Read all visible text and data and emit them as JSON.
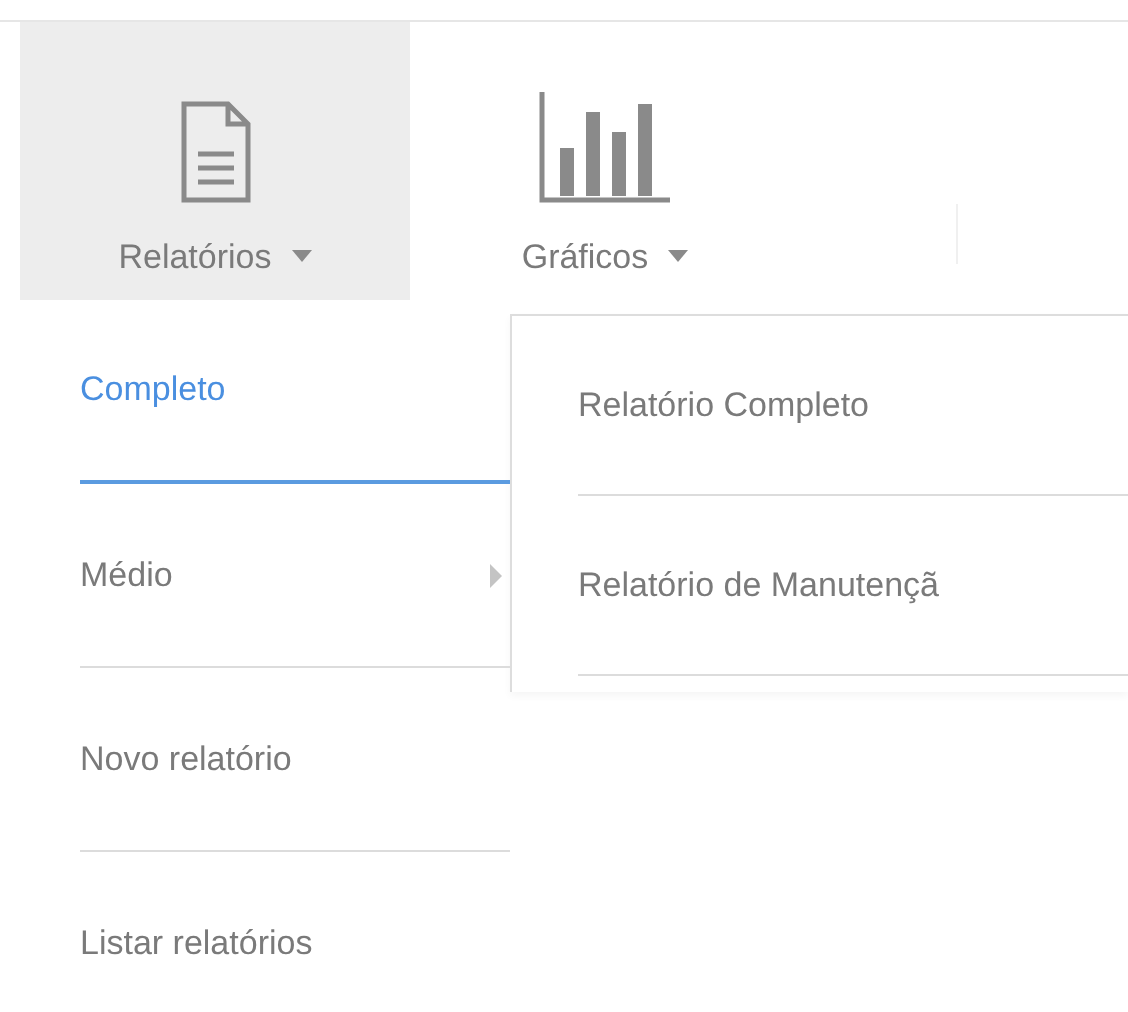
{
  "toolbar": {
    "tabs": [
      {
        "label": "Relatórios",
        "kind": "document",
        "selected": true,
        "menu": [
          {
            "label": "Completo",
            "selected": true,
            "has_submenu": false
          },
          {
            "label": "Médio",
            "selected": false,
            "has_submenu": true
          },
          {
            "label": "Novo relatório",
            "selected": false,
            "has_submenu": false
          },
          {
            "label": "Listar relatórios",
            "selected": false,
            "has_submenu": false
          }
        ]
      },
      {
        "label": "Gráficos",
        "kind": "chart",
        "selected": false,
        "menu": [
          {
            "label": "Relatório Completo",
            "selected": false,
            "has_submenu": false
          },
          {
            "label": "Relatório de Manutençã",
            "selected": false,
            "has_submenu": false
          }
        ]
      }
    ]
  }
}
